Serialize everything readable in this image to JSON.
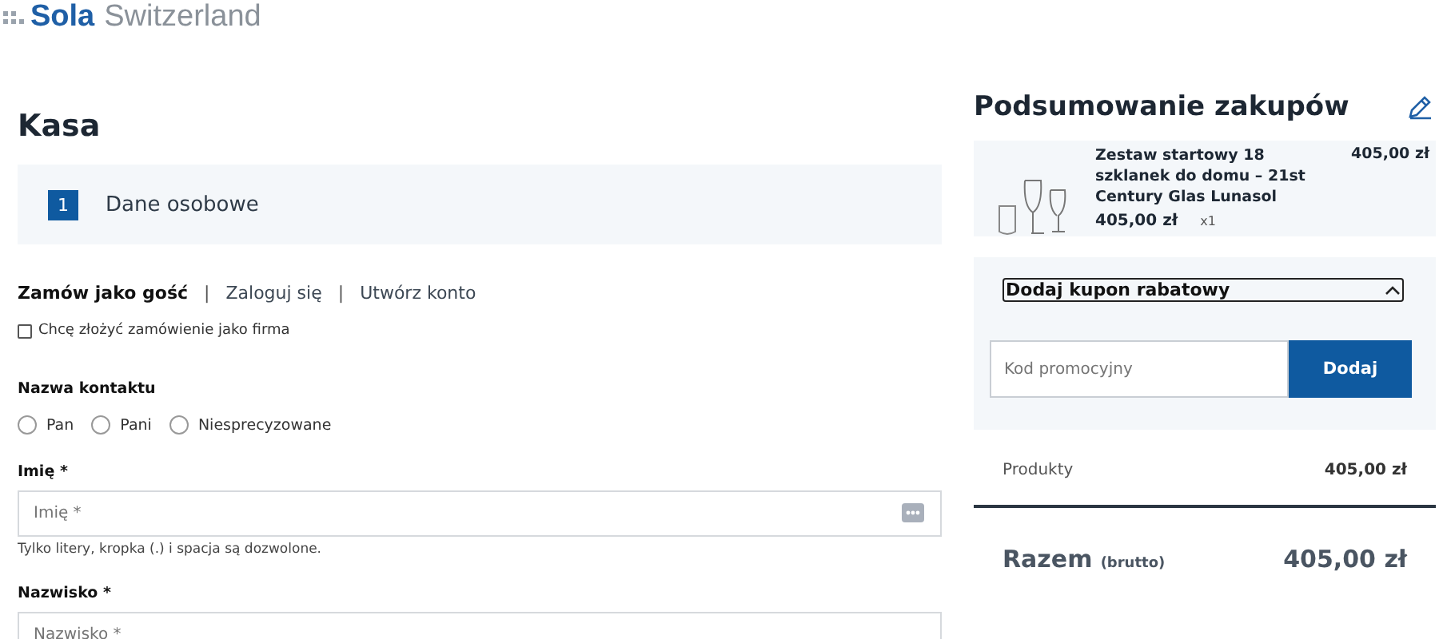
{
  "logo": {
    "brand": "Sola",
    "suffix": "Switzerland"
  },
  "checkout": {
    "title": "Kasa",
    "step": {
      "number": "1",
      "label": "Dane osobowe"
    },
    "tabs": [
      {
        "label": "Zamów jako gość",
        "selected": true
      },
      {
        "label": "Zaloguj się",
        "selected": false
      },
      {
        "label": "Utwórz konto",
        "selected": false
      }
    ],
    "separator": "|",
    "company_checkbox": {
      "label": "Chcę złożyć zamówienie jako firma",
      "checked": false
    },
    "contact": {
      "label": "Nazwa kontaktu",
      "options": [
        {
          "label": "Pan",
          "selected": false
        },
        {
          "label": "Pani",
          "selected": false
        },
        {
          "label": "Niesprecyzowane",
          "selected": false
        }
      ]
    },
    "fields": [
      {
        "label": "Imię *",
        "placeholder": "Imię *",
        "hint": "Tylko litery, kropka (.) i spacja są dozwolone.",
        "autofill_icon": true
      },
      {
        "label": "Nazwisko *",
        "placeholder": "Nazwisko *",
        "autofill_icon": false
      }
    ]
  },
  "summary": {
    "title": "Podsumowanie zakupów",
    "item": {
      "name": "Zestaw startowy 18 szklanek do domu – 21st Century Glas Lunasol",
      "price": "405,00 zł",
      "unit_price": "405,00 zł",
      "quantity": "x1"
    },
    "coupon": {
      "toggle": "Dodaj kupon rabatowy",
      "expanded": true,
      "placeholder": "Kod promocyjny",
      "button": "Dodaj"
    },
    "products": {
      "label": "Produkty",
      "value": "405,00 zł"
    },
    "total": {
      "label": "Razem",
      "note": "(brutto)",
      "value": "405,00 zł"
    }
  }
}
